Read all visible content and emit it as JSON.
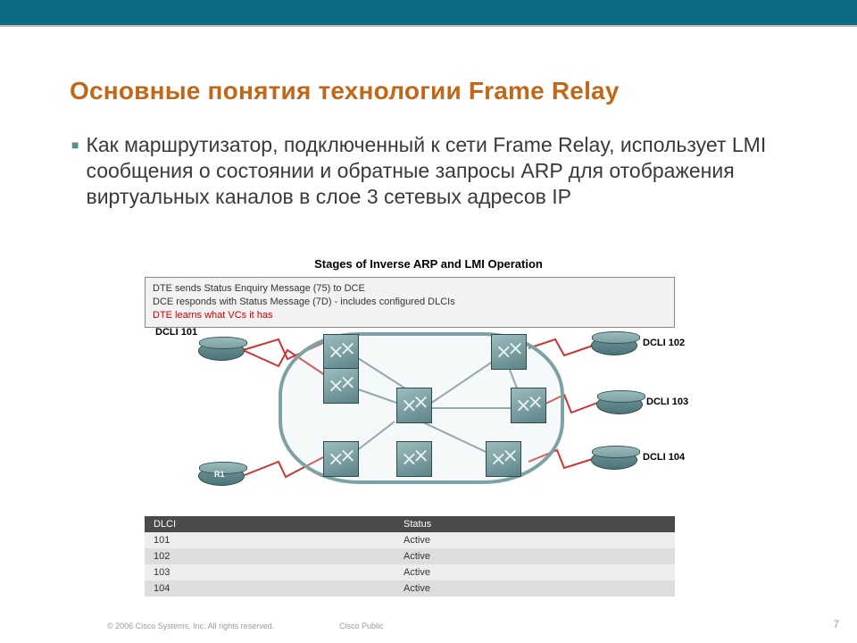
{
  "title": "Основные понятия технологии Frame Relay",
  "bullet": "Как маршрутизатор, подключенный к сети Frame Relay, использует LMI сообщения о состоянии и обратные запросы ARP для отображения виртуальных каналов в слое 3 сетевых адресов IP",
  "diagram_title": "Stages of Inverse ARP and LMI Operation",
  "info_lines": {
    "l1": "DTE sends Status Enquiry Message (75) to DCE",
    "l2": "DCE responds with Status Message (7D) - includes configured DLCIs",
    "l3": "DTE learns what VCs it has"
  },
  "labels": {
    "dlci101": "DCLI 101",
    "dlci102": "DCLI 102",
    "dlci103": "DCLI 103",
    "dlci104": "DCLI 104",
    "r1": "R1"
  },
  "table": {
    "head": {
      "c1": "DLCI",
      "c2": "Status"
    },
    "rows": [
      {
        "c1": "101",
        "c2": "Active"
      },
      {
        "c1": "102",
        "c2": "Active"
      },
      {
        "c1": "103",
        "c2": "Active"
      },
      {
        "c1": "104",
        "c2": "Active"
      }
    ]
  },
  "footer": {
    "copy": "© 2006 Cisco Systems, Inc. All rights reserved.",
    "pub": "Cisco Public",
    "num": "7"
  }
}
